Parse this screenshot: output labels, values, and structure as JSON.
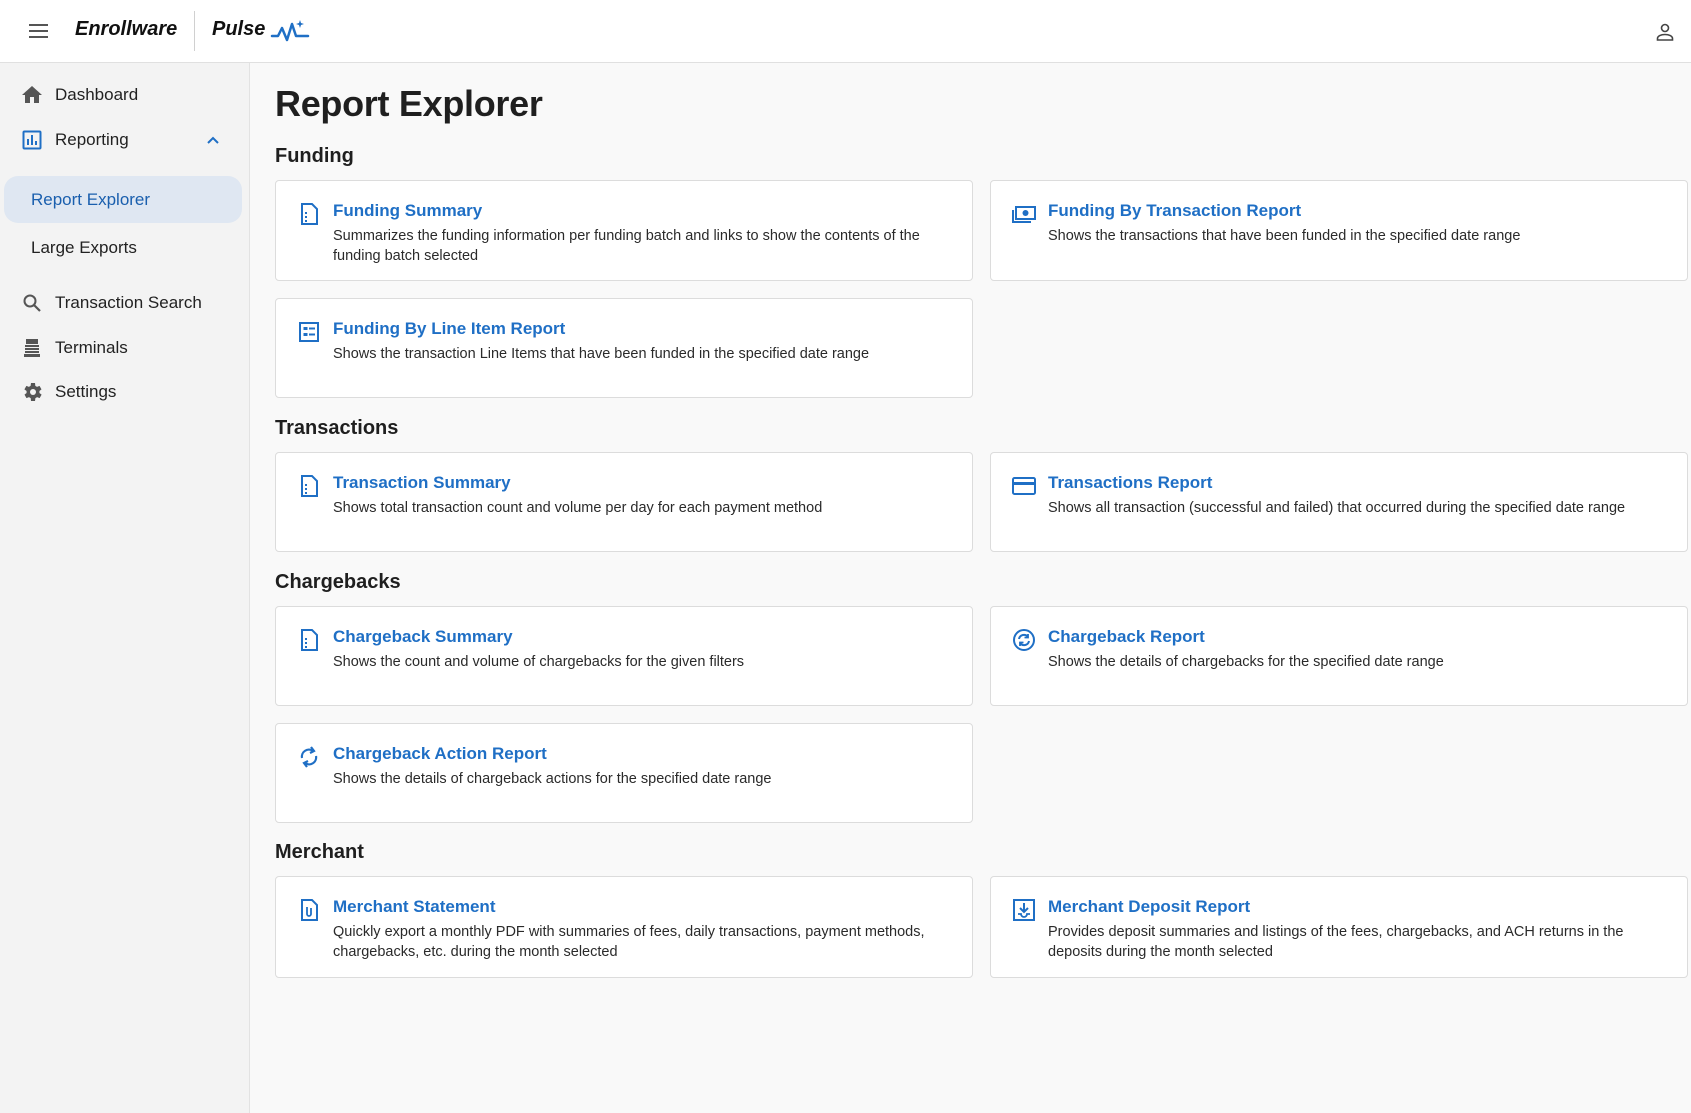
{
  "header": {
    "brand_left": "Enrollware",
    "brand_right": "Pulse",
    "menu_icon": "hamburger-menu-icon",
    "user_icon": "user-account-icon"
  },
  "sidebar": {
    "items": [
      {
        "label": "Dashboard",
        "icon": "home-icon"
      },
      {
        "label": "Reporting",
        "icon": "bar-chart-icon",
        "expanded": true
      },
      {
        "label": "Transaction Search",
        "icon": "search-icon"
      },
      {
        "label": "Terminals",
        "icon": "terminal-icon"
      },
      {
        "label": "Settings",
        "icon": "gear-icon"
      }
    ],
    "reporting_sub": [
      {
        "label": "Report Explorer",
        "active": true
      },
      {
        "label": "Large Exports",
        "active": false
      }
    ]
  },
  "page": {
    "title": "Report Explorer"
  },
  "sections": [
    {
      "title": "Funding",
      "cards": [
        {
          "title": "Funding Summary",
          "desc": "Summarizes the funding information per funding batch and links to show the contents of the funding batch selected",
          "icon": "summary-document-icon"
        },
        {
          "title": "Funding By Transaction Report",
          "desc": "Shows the transactions that have been funded in the specified date range",
          "icon": "money-icon"
        },
        {
          "title": "Funding By Line Item Report",
          "desc": "Shows the transaction Line Items that have been funded in the specified date range",
          "icon": "list-alt-icon"
        }
      ]
    },
    {
      "title": "Transactions",
      "cards": [
        {
          "title": "Transaction Summary",
          "desc": "Shows total transaction count and volume per day for each payment method",
          "icon": "summary-document-icon"
        },
        {
          "title": "Transactions Report",
          "desc": "Shows all transaction (successful and failed) that occurred during the specified date range",
          "icon": "credit-card-icon"
        }
      ]
    },
    {
      "title": "Chargebacks",
      "cards": [
        {
          "title": "Chargeback Summary",
          "desc": "Shows the count and volume of chargebacks for the given filters",
          "icon": "summary-document-icon"
        },
        {
          "title": "Chargeback Report",
          "desc": "Shows the details of chargebacks for the specified date range",
          "icon": "currency-exchange-icon"
        },
        {
          "title": "Chargeback Action Report",
          "desc": "Shows the details of chargeback actions for the specified date range",
          "icon": "sync-icon"
        }
      ]
    },
    {
      "title": "Merchant",
      "cards": [
        {
          "title": "Merchant Statement",
          "desc": "Quickly export a monthly PDF with summaries of fees, daily transactions, payment methods, chargebacks, etc. during the month selected",
          "icon": "attachment-document-icon"
        },
        {
          "title": "Merchant Deposit Report",
          "desc": "Provides deposit summaries and listings of the fees, chargebacks, and ACH returns in the deposits during the month selected",
          "icon": "download-box-icon"
        }
      ]
    }
  ],
  "colors": {
    "accent": "#1f6fc5",
    "active_nav_bg": "#dfe7f2",
    "active_nav_text": "#1a5fae"
  }
}
